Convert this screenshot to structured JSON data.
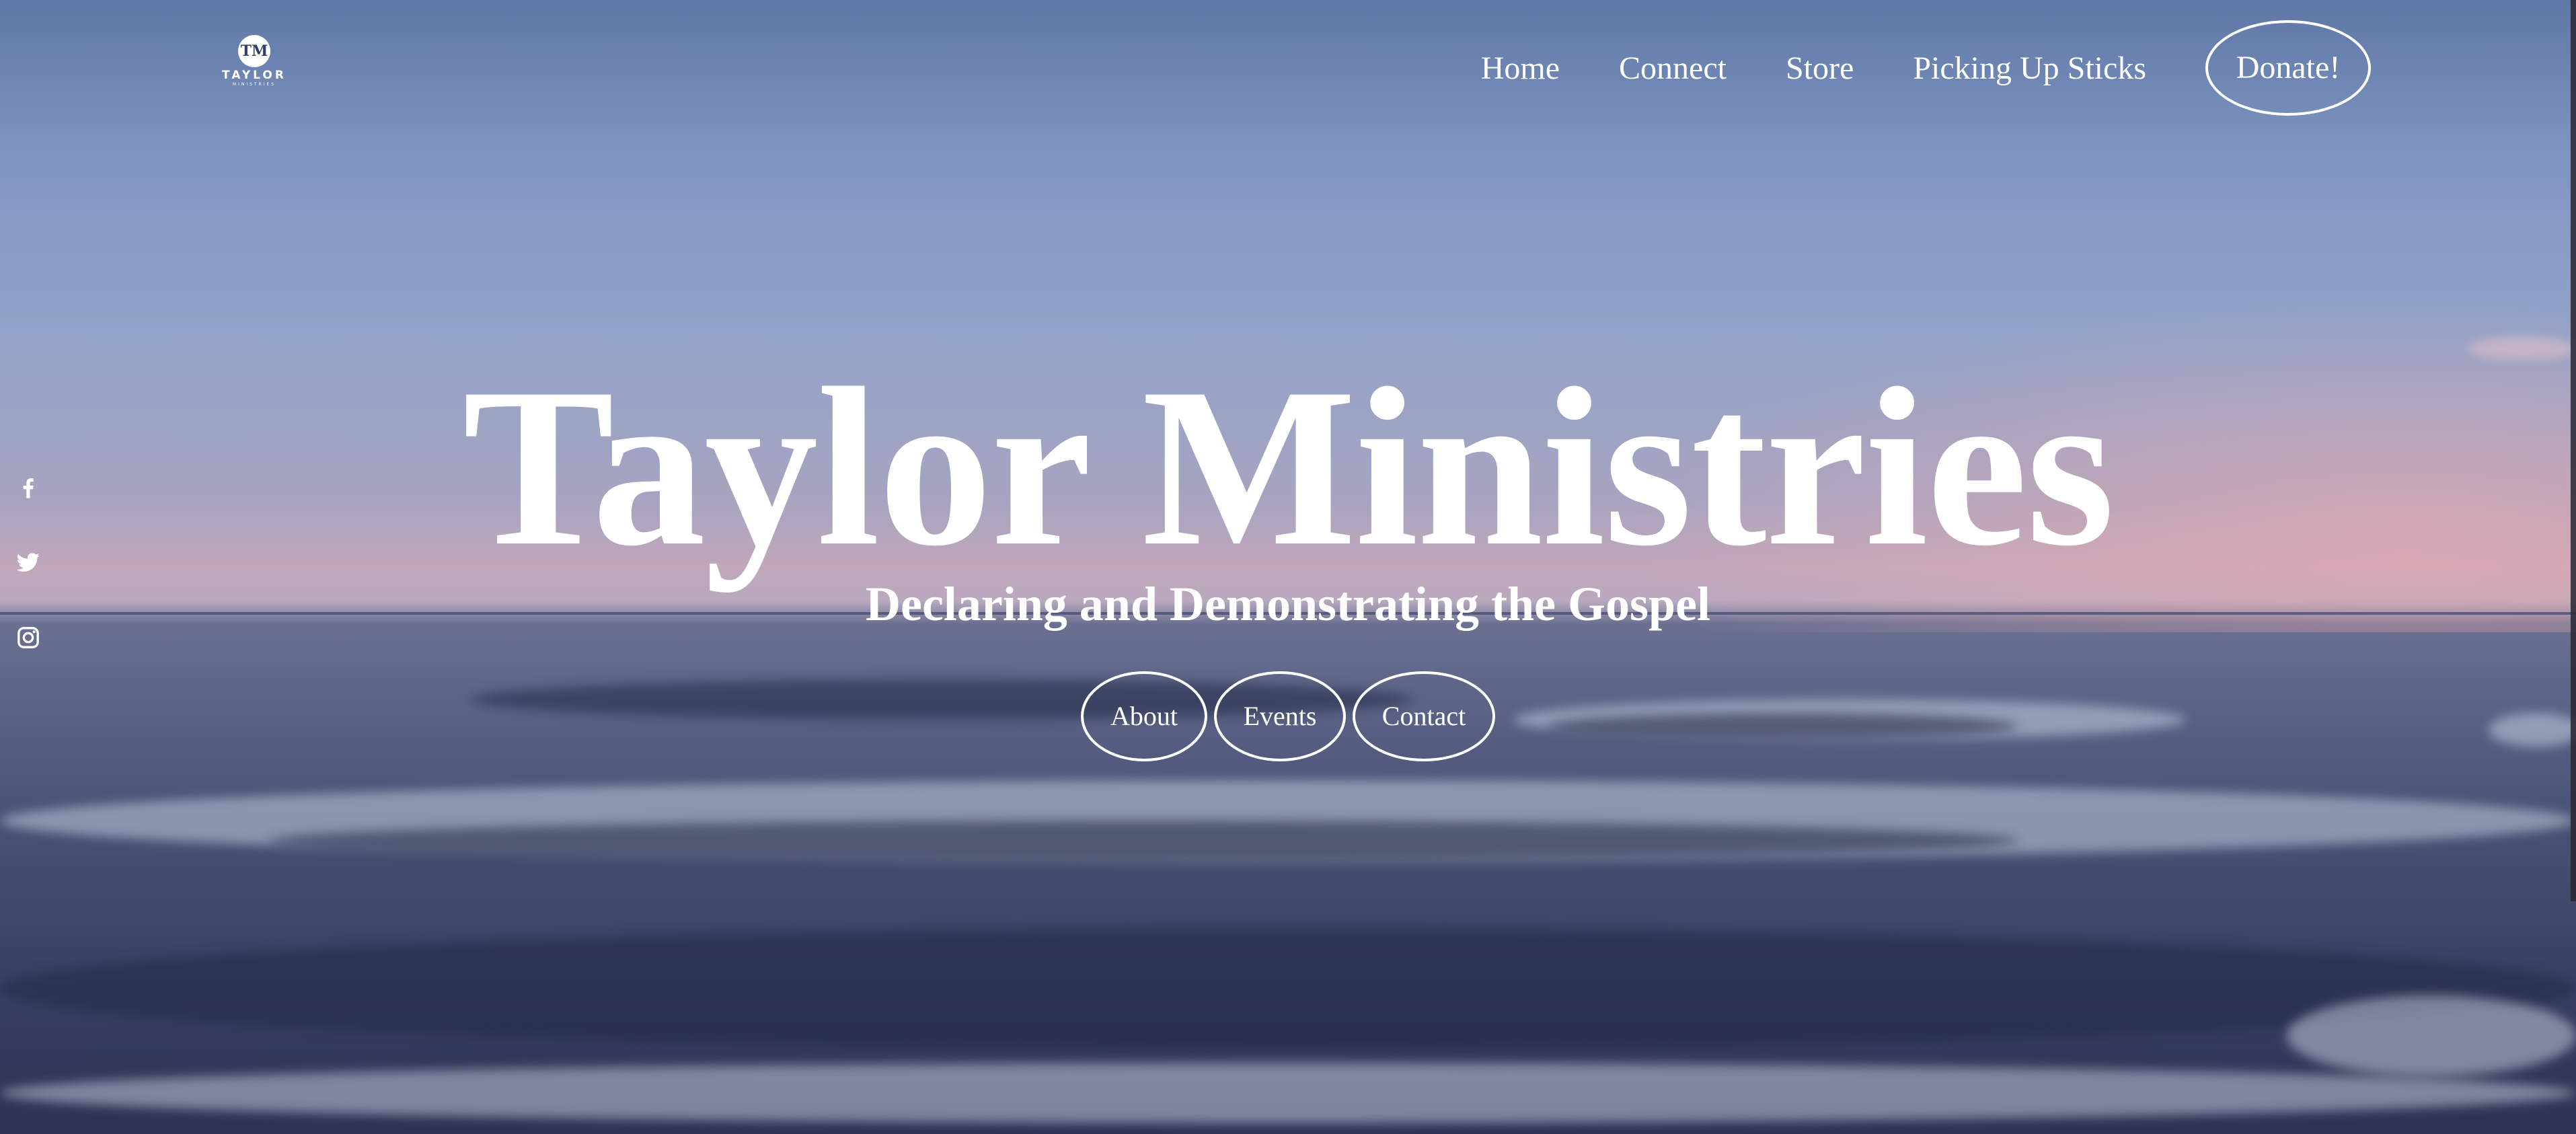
{
  "brand": {
    "logo_mark": "TM",
    "logo_word": "TAYLOR",
    "logo_sub": "MINISTRIES"
  },
  "nav": {
    "items": [
      {
        "label": "Home"
      },
      {
        "label": "Connect"
      },
      {
        "label": "Store"
      },
      {
        "label": "Picking Up Sticks"
      }
    ],
    "donate_label": "Donate!"
  },
  "social": [
    {
      "icon": "facebook-icon"
    },
    {
      "icon": "twitter-icon"
    },
    {
      "icon": "instagram-icon"
    }
  ],
  "hero": {
    "title": "Taylor Ministries",
    "subtitle": "Declaring and Demonstrating the Gospel",
    "buttons": [
      {
        "label": "About"
      },
      {
        "label": "Events"
      },
      {
        "label": "Contact"
      }
    ]
  },
  "colors": {
    "text": "#ffffff",
    "sky": "#7f96c2",
    "sea": "#3b4163"
  }
}
